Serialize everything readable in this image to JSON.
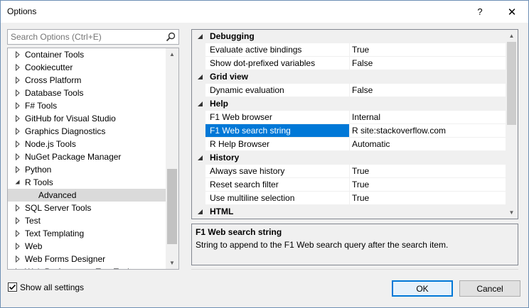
{
  "window": {
    "title": "Options",
    "help_glyph": "?",
    "close_glyph": "✕"
  },
  "search": {
    "placeholder": "Search Options (Ctrl+E)"
  },
  "tree": {
    "items": [
      {
        "label": "Container Tools",
        "expanded": false
      },
      {
        "label": "Cookiecutter",
        "expanded": false
      },
      {
        "label": "Cross Platform",
        "expanded": false
      },
      {
        "label": "Database Tools",
        "expanded": false
      },
      {
        "label": "F# Tools",
        "expanded": false
      },
      {
        "label": "GitHub for Visual Studio",
        "expanded": false
      },
      {
        "label": "Graphics Diagnostics",
        "expanded": false
      },
      {
        "label": "Node.js Tools",
        "expanded": false
      },
      {
        "label": "NuGet Package Manager",
        "expanded": false
      },
      {
        "label": "Python",
        "expanded": false
      },
      {
        "label": "R Tools",
        "expanded": true
      },
      {
        "label": "Advanced",
        "child": true,
        "selected": true
      },
      {
        "label": "SQL Server Tools",
        "expanded": false
      },
      {
        "label": "Test",
        "expanded": false
      },
      {
        "label": "Text Templating",
        "expanded": false
      },
      {
        "label": "Web",
        "expanded": false
      },
      {
        "label": "Web Forms Designer",
        "expanded": false
      },
      {
        "label": "Web Performance Test Tools",
        "expanded": false
      }
    ]
  },
  "grid": {
    "rows": [
      {
        "type": "category",
        "label": "Debugging"
      },
      {
        "type": "prop",
        "name": "Evaluate active bindings",
        "value": "True"
      },
      {
        "type": "prop",
        "name": "Show dot-prefixed variables",
        "value": "False"
      },
      {
        "type": "category",
        "label": "Grid view"
      },
      {
        "type": "prop",
        "name": "Dynamic evaluation",
        "value": "False"
      },
      {
        "type": "category",
        "label": "Help"
      },
      {
        "type": "prop",
        "name": "F1 Web browser",
        "value": "Internal"
      },
      {
        "type": "prop",
        "name": "F1 Web search string",
        "value": "R site:stackoverflow.com",
        "selected": true
      },
      {
        "type": "prop",
        "name": "R Help Browser",
        "value": "Automatic"
      },
      {
        "type": "category",
        "label": "History"
      },
      {
        "type": "prop",
        "name": "Always save history",
        "value": "True"
      },
      {
        "type": "prop",
        "name": "Reset search filter",
        "value": "True"
      },
      {
        "type": "prop",
        "name": "Use multiline selection",
        "value": "True"
      },
      {
        "type": "category",
        "label": "HTML"
      }
    ]
  },
  "description": {
    "title": "F1 Web search string",
    "text": "String to append to the F1 Web search query after the search item."
  },
  "footer": {
    "show_all_label": "Show all settings",
    "show_all_checked": true,
    "ok_label": "OK",
    "cancel_label": "Cancel"
  },
  "colors": {
    "selection": "#0078d7",
    "tree_selection": "#dadada",
    "border": "#6d8fb4"
  }
}
